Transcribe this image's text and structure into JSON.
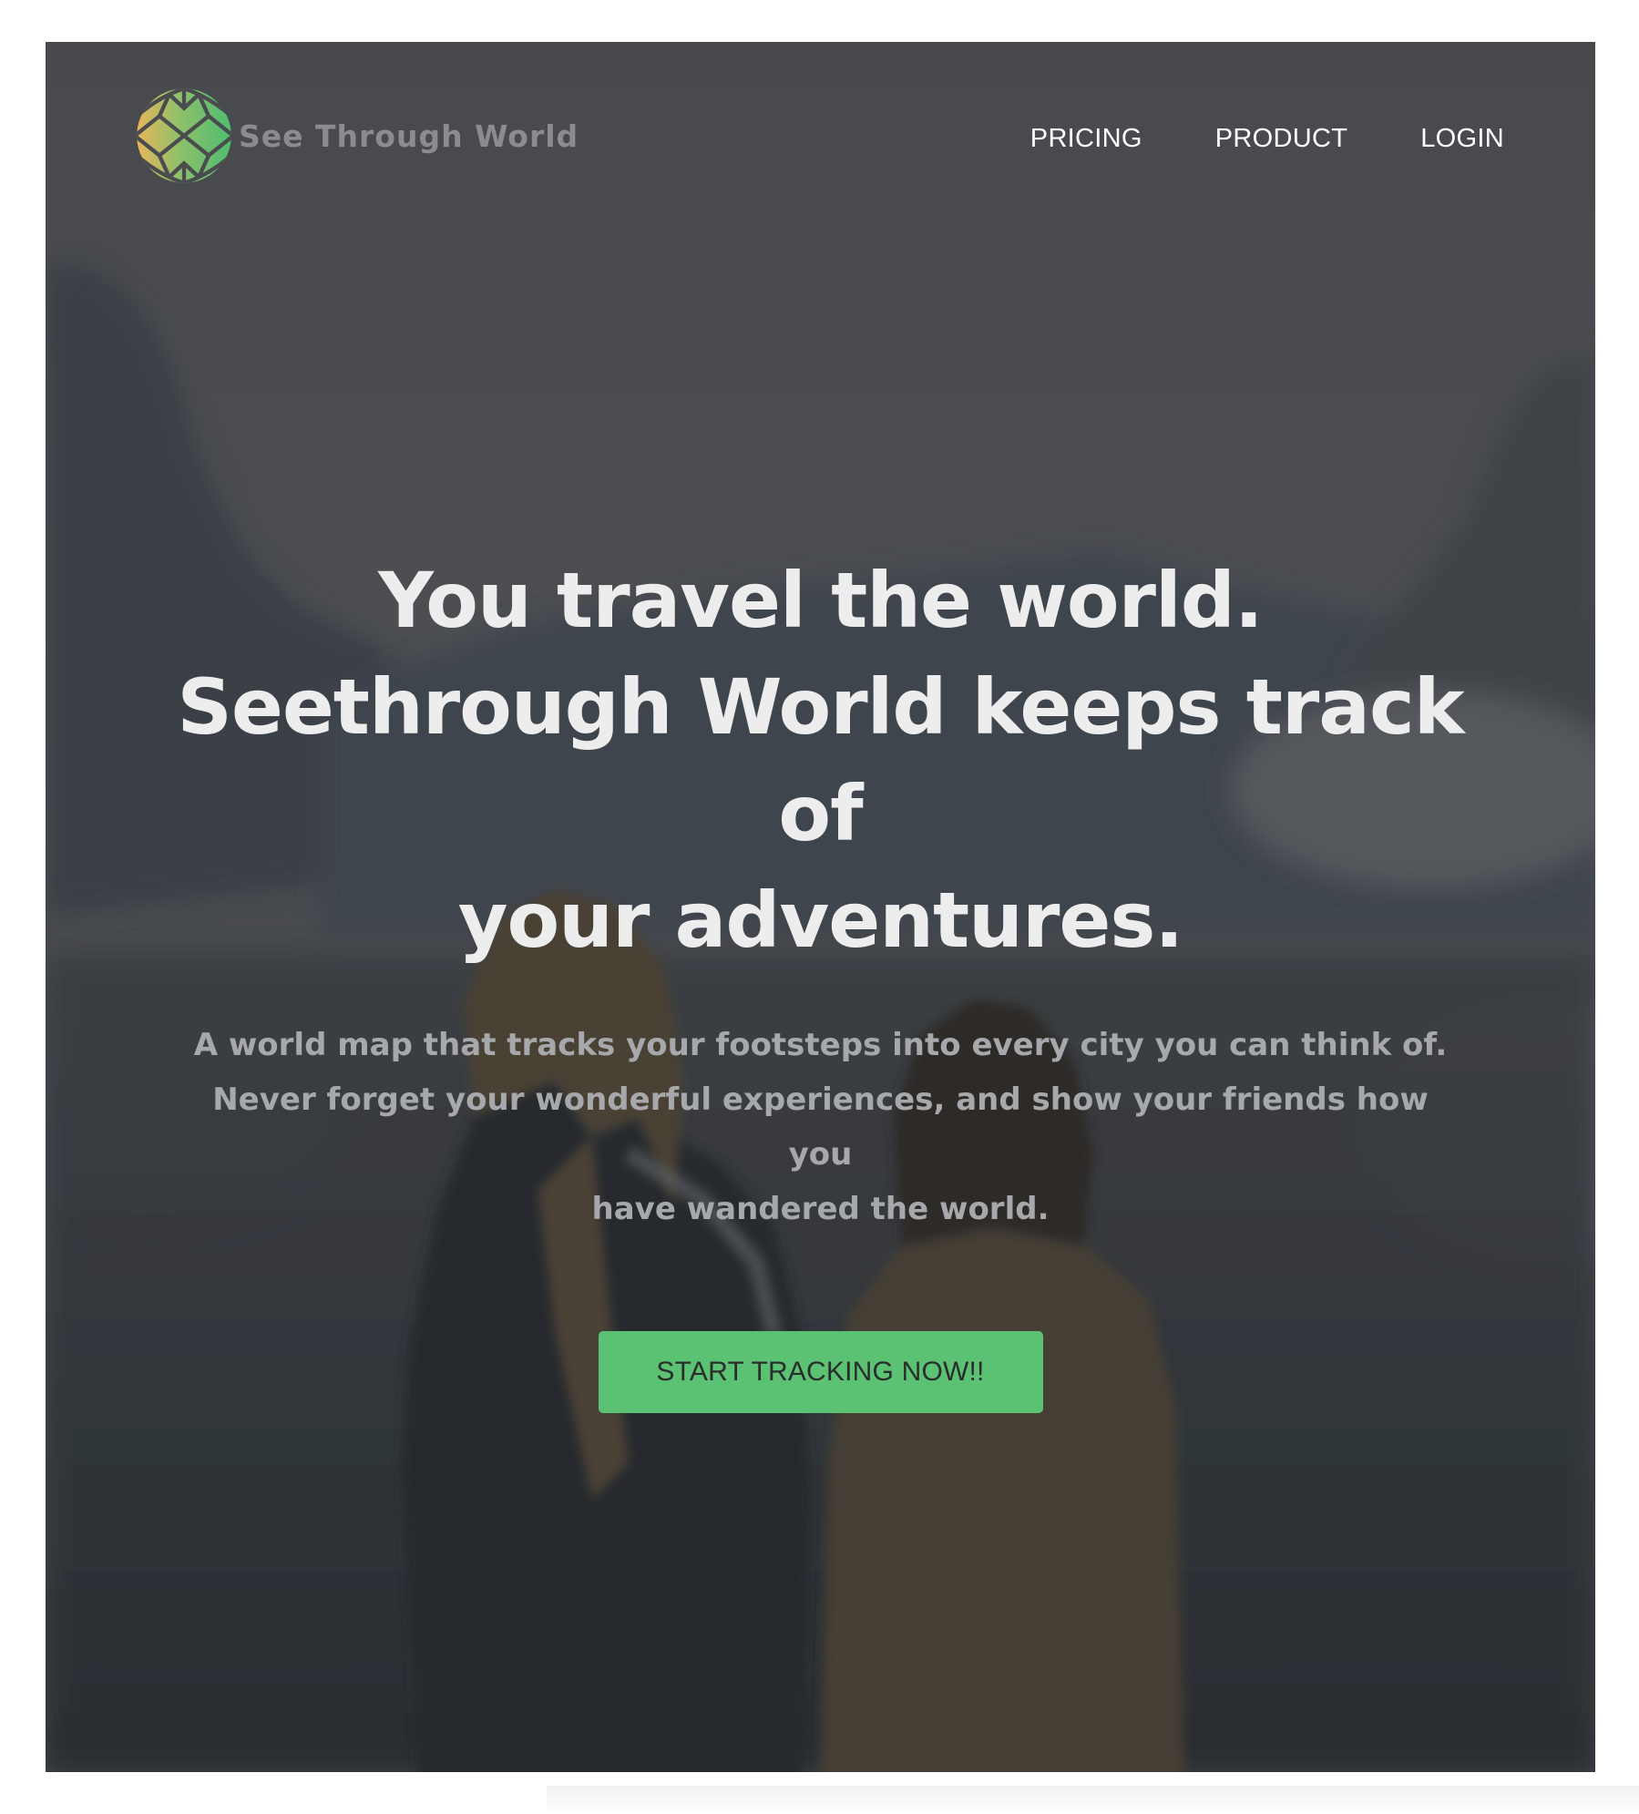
{
  "brand": {
    "name": "See Through World",
    "logo_icon": "globe-mosaic-icon",
    "colors": {
      "accent_green": "#5bc274",
      "logo_yellow": "#e8b65a",
      "logo_green": "#5cbf72"
    }
  },
  "nav": {
    "items": [
      {
        "label": "PRICING"
      },
      {
        "label": "PRODUCT"
      },
      {
        "label": "LOGIN"
      }
    ]
  },
  "hero": {
    "headline_lines": [
      "You travel the world.",
      "Seethrough World keeps track of",
      "your adventures."
    ],
    "subtext_lines": [
      "A world map that tracks your footsteps into every city you can think of.",
      "Never forget your wonderful experiences, and show your friends how you",
      "have wandered the world."
    ],
    "cta_label": "START TRACKING NOW!!"
  }
}
